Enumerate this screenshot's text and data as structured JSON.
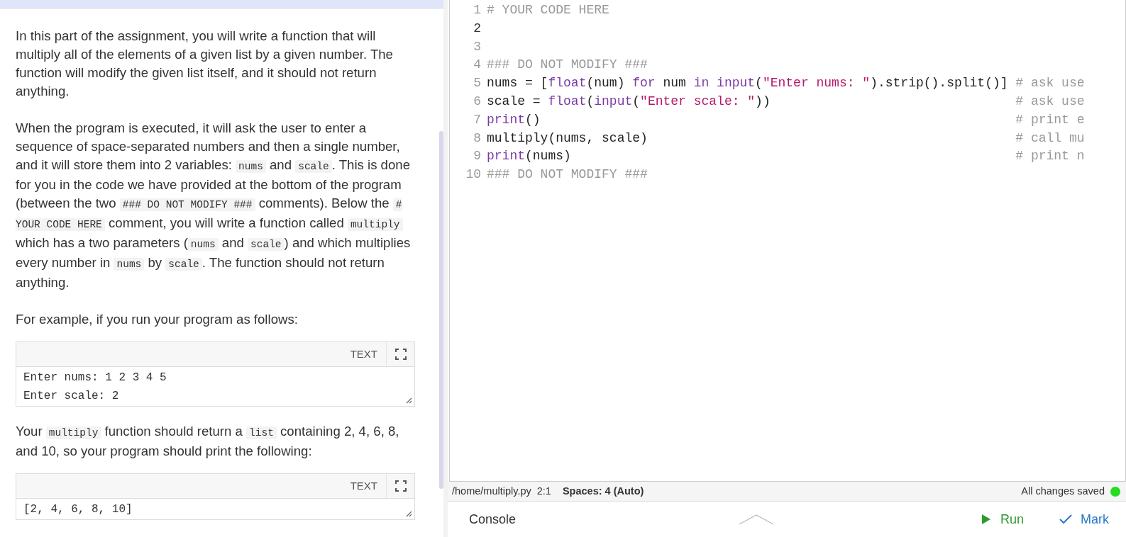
{
  "assignment": {
    "content": [
      {
        "kind": "paragraph",
        "segments": [
          {
            "text": "In this part of the assignment, you will write a function that will multiply all of the elements of a given list by a given number. The function will modify the given list itself, and it should not return anything.",
            "code": false
          }
        ]
      },
      {
        "kind": "paragraph",
        "segments": [
          {
            "text": "When the program is executed, it will ask the user to enter a sequence of space-separated numbers and then a single number, and it will store them into 2 variables: ",
            "code": false
          },
          {
            "text": "nums",
            "code": true
          },
          {
            "text": " and ",
            "code": false
          },
          {
            "text": "scale",
            "code": true
          },
          {
            "text": ". This is done for you in the code we have provided at the bottom of the program (between the two ",
            "code": false
          },
          {
            "text": "### DO NOT MODIFY ###",
            "code": true
          },
          {
            "text": " comments). Below the ",
            "code": false
          },
          {
            "text": "# YOUR CODE HERE",
            "code": true
          },
          {
            "text": " comment, you will write a function called ",
            "code": false
          },
          {
            "text": "multiply",
            "code": true
          },
          {
            "text": " which has a two parameters (",
            "code": false
          },
          {
            "text": "nums",
            "code": true
          },
          {
            "text": " and ",
            "code": false
          },
          {
            "text": "scale",
            "code": true
          },
          {
            "text": ") and which multiplies every number in ",
            "code": false
          },
          {
            "text": "nums",
            "code": true
          },
          {
            "text": " by ",
            "code": false
          },
          {
            "text": "scale",
            "code": true
          },
          {
            "text": ". The function should not return anything.",
            "code": false
          }
        ]
      },
      {
        "kind": "paragraph",
        "segments": [
          {
            "text": "For example, if you run your program as follows:",
            "code": false
          }
        ]
      },
      {
        "kind": "example",
        "label": "TEXT",
        "lines": [
          "Enter nums: 1 2 3 4 5",
          "Enter scale: 2"
        ]
      },
      {
        "kind": "paragraph",
        "segments": [
          {
            "text": "Your ",
            "code": false
          },
          {
            "text": "multiply",
            "code": true
          },
          {
            "text": " function should return a ",
            "code": false
          },
          {
            "text": "list",
            "code": true
          },
          {
            "text": " containing 2, 4, 6, 8, and 10, so your program should print the following:",
            "code": false
          }
        ]
      },
      {
        "kind": "example",
        "label": "TEXT",
        "lines": [
          "[2, 4, 6, 8, 10]"
        ]
      }
    ]
  },
  "editor": {
    "lines": [
      {
        "number": "1",
        "active": false,
        "tokens": [
          {
            "kind": "comment",
            "text": "# YOUR CODE HERE"
          }
        ]
      },
      {
        "number": "2",
        "active": true
      },
      {
        "number": "3",
        "active": false
      },
      {
        "number": "4",
        "active": false,
        "tokens": [
          {
            "kind": "comment",
            "text": "### DO NOT MODIFY ###"
          }
        ]
      },
      {
        "number": "5",
        "active": false,
        "tokens": [
          {
            "kind": "plain",
            "text": "nums = ["
          },
          {
            "kind": "builtin",
            "text": "float"
          },
          {
            "kind": "plain",
            "text": "(num) "
          },
          {
            "kind": "keyword",
            "text": "for"
          },
          {
            "kind": "plain",
            "text": " num "
          },
          {
            "kind": "keyword",
            "text": "in"
          },
          {
            "kind": "builtin",
            "text": " input"
          },
          {
            "kind": "plain",
            "text": "("
          },
          {
            "kind": "string",
            "text": "\"Enter nums: \""
          },
          {
            "kind": "plain",
            "text": ").strip().split()]"
          }
        ],
        "comment": "# ask use"
      },
      {
        "number": "6",
        "active": false,
        "tokens": [
          {
            "kind": "plain",
            "text": "scale = "
          },
          {
            "kind": "builtin",
            "text": "float"
          },
          {
            "kind": "plain",
            "text": "("
          },
          {
            "kind": "builtin",
            "text": "input"
          },
          {
            "kind": "plain",
            "text": "("
          },
          {
            "kind": "string",
            "text": "\"Enter scale: \""
          },
          {
            "kind": "plain",
            "text": "))"
          }
        ],
        "comment": "# ask use"
      },
      {
        "number": "7",
        "active": false,
        "tokens": [
          {
            "kind": "builtin",
            "text": "print"
          },
          {
            "kind": "plain",
            "text": "()"
          }
        ],
        "comment": "# print e"
      },
      {
        "number": "8",
        "active": false,
        "tokens": [
          {
            "kind": "plain",
            "text": "multiply(nums, scale)"
          }
        ],
        "comment": "# call mu"
      },
      {
        "number": "9",
        "active": false,
        "tokens": [
          {
            "kind": "builtin",
            "text": "print"
          },
          {
            "kind": "plain",
            "text": "(nums)"
          }
        ],
        "comment": "# print n"
      },
      {
        "number": "10",
        "active": false,
        "tokens": [
          {
            "kind": "comment",
            "text": "### DO NOT MODIFY ###"
          }
        ]
      }
    ]
  },
  "status_bar": {
    "path": "/home/multiply.py",
    "cursor": "2:1",
    "indent": "Spaces: 4 (Auto)",
    "save_status": "All changes saved",
    "saved": true
  },
  "bottom_bar": {
    "console": "Console",
    "run": "Run",
    "mark": "Mark"
  }
}
